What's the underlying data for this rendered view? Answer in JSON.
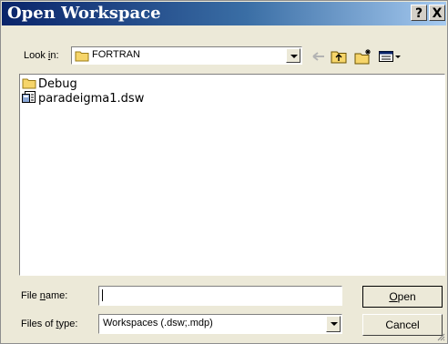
{
  "window": {
    "title": "Open Workspace",
    "help_label": "?",
    "close_label": "X"
  },
  "lookin": {
    "label_pre": "Look ",
    "label_accel": "i",
    "label_post": "n:",
    "value": "FORTRAN"
  },
  "toolbar": {
    "back_icon": "back-arrow-icon",
    "up_icon": "up-folder-icon",
    "new_folder_icon": "new-folder-icon",
    "view_menu_icon": "view-menu-icon"
  },
  "files": [
    {
      "name": "Debug",
      "icon": "folder-icon"
    },
    {
      "name": "paradeigma1.dsw",
      "icon": "workspace-file-icon"
    }
  ],
  "filename": {
    "label_pre": "File ",
    "label_accel": "n",
    "label_post": "ame:",
    "value": ""
  },
  "filetype": {
    "label_pre": "Files of ",
    "label_accel": "t",
    "label_post": "ype:",
    "value": "Workspaces (.dsw;.mdp)"
  },
  "buttons": {
    "open_accel": "O",
    "open_rest": "pen",
    "cancel": "Cancel"
  },
  "colors": {
    "titlebar_start": "#0a246a",
    "titlebar_end": "#a6caf0",
    "dialog_bg": "#ece9d8",
    "folder": "#f6d56a"
  }
}
